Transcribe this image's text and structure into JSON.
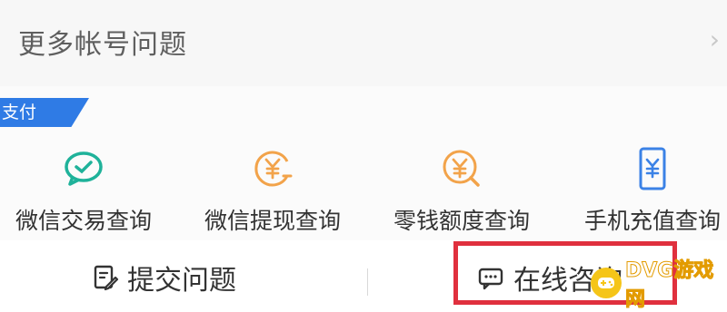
{
  "account_row": {
    "label": "更多帐号问题",
    "chevron_icon": "chevron-right-icon"
  },
  "payment_section": {
    "tag": "支付",
    "tag_color": "#2f7be5",
    "items": [
      {
        "label": "微信交易查询",
        "icon": "chat-check-icon",
        "color": "#1fb29a"
      },
      {
        "label": "微信提现查询",
        "icon": "yuan-withdraw-icon",
        "color": "#f2a34a"
      },
      {
        "label": "零钱额度查询",
        "icon": "yuan-search-icon",
        "color": "#f2a34a"
      },
      {
        "label": "手机充值查询",
        "icon": "phone-yuan-icon",
        "color": "#3b82e6"
      }
    ]
  },
  "bottom_bar": {
    "submit_label": "提交问题",
    "online_label": "在线咨询",
    "highlight_color": "#e0303e"
  },
  "watermark": {
    "text": "DVG游戏网"
  }
}
